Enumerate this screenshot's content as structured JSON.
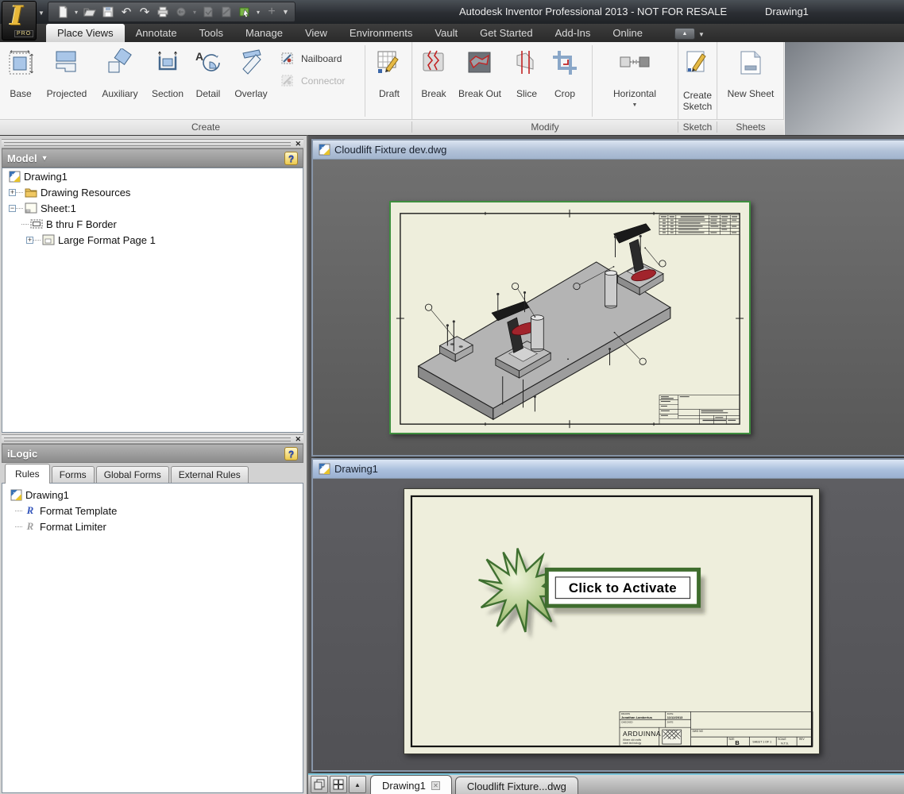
{
  "titlebar": {
    "app_title": "Autodesk Inventor Professional 2013 - NOT FOR RESALE",
    "doc_title": "Drawing1",
    "logo_badge": "PRO"
  },
  "ribbon": {
    "tabs": [
      {
        "label": "Place Views",
        "active": true
      },
      {
        "label": "Annotate"
      },
      {
        "label": "Tools"
      },
      {
        "label": "Manage"
      },
      {
        "label": "View"
      },
      {
        "label": "Environments"
      },
      {
        "label": "Vault"
      },
      {
        "label": "Get Started"
      },
      {
        "label": "Add-Ins"
      },
      {
        "label": "Online"
      }
    ],
    "create": {
      "label": "Create",
      "base": "Base",
      "projected": "Projected",
      "auxiliary": "Auxiliary",
      "section": "Section",
      "detail": "Detail",
      "overlay": "Overlay",
      "nailboard": "Nailboard",
      "connector": "Connector",
      "draft": "Draft"
    },
    "modify": {
      "label": "Modify",
      "break": "Break",
      "break_out": "Break Out",
      "slice": "Slice",
      "crop": "Crop",
      "horizontal": "Horizontal"
    },
    "sketch": {
      "label": "Sketch",
      "create_sketch_line1": "Create",
      "create_sketch_line2": "Sketch"
    },
    "sheets": {
      "label": "Sheets",
      "new_sheet": "New Sheet"
    }
  },
  "model_panel": {
    "title": "Model",
    "items": [
      {
        "label": "Drawing1"
      },
      {
        "label": "Drawing Resources"
      },
      {
        "label": "Sheet:1"
      },
      {
        "label": "B thru F Border"
      },
      {
        "label": "Large Format Page 1"
      }
    ]
  },
  "ilogic": {
    "title": "iLogic",
    "tabs": [
      {
        "label": "Rules",
        "active": true
      },
      {
        "label": "Forms"
      },
      {
        "label": "Global Forms"
      },
      {
        "label": "External Rules"
      }
    ],
    "items": [
      {
        "label": "Drawing1"
      },
      {
        "label": "Format Template"
      },
      {
        "label": "Format Limiter"
      }
    ]
  },
  "doc_windows": [
    {
      "title": "Cloudlift Fixture dev.dwg"
    },
    {
      "title": "Drawing1"
    }
  ],
  "activate": {
    "button_label": "Click to Activate"
  },
  "titleblock": {
    "drawn_label": "DRAWN",
    "drawn_value": "Jonathan Lambertus",
    "date_label": "DATE",
    "date_value": "11/12/2013",
    "checked_label": "CHECKED",
    "qa_label": "DATE",
    "company": "ARDUINNA",
    "tagline_line1": "Where old crafts",
    "tagline_line2": "meet technology",
    "dwg_no_label": "DWG NO",
    "size_label": "SIZE",
    "size_value": "B",
    "sheet_value": "SHEET 1 OF 1",
    "scale_label": "SCALE",
    "scale_value": "N.T.S.",
    "rev_label": "REV"
  },
  "bottom_tabs": [
    {
      "label": "Drawing1",
      "active": true
    },
    {
      "label": "Cloudlift Fixture...dwg"
    }
  ],
  "colors": {
    "sheet_cream": "#eeeedc",
    "sheet_border_green": "#3f8f3f",
    "activate_green": "#3f6d2e",
    "clamp_handle_red": "#a1242c",
    "doc_titlebar_blue": "#b2c2d8"
  }
}
